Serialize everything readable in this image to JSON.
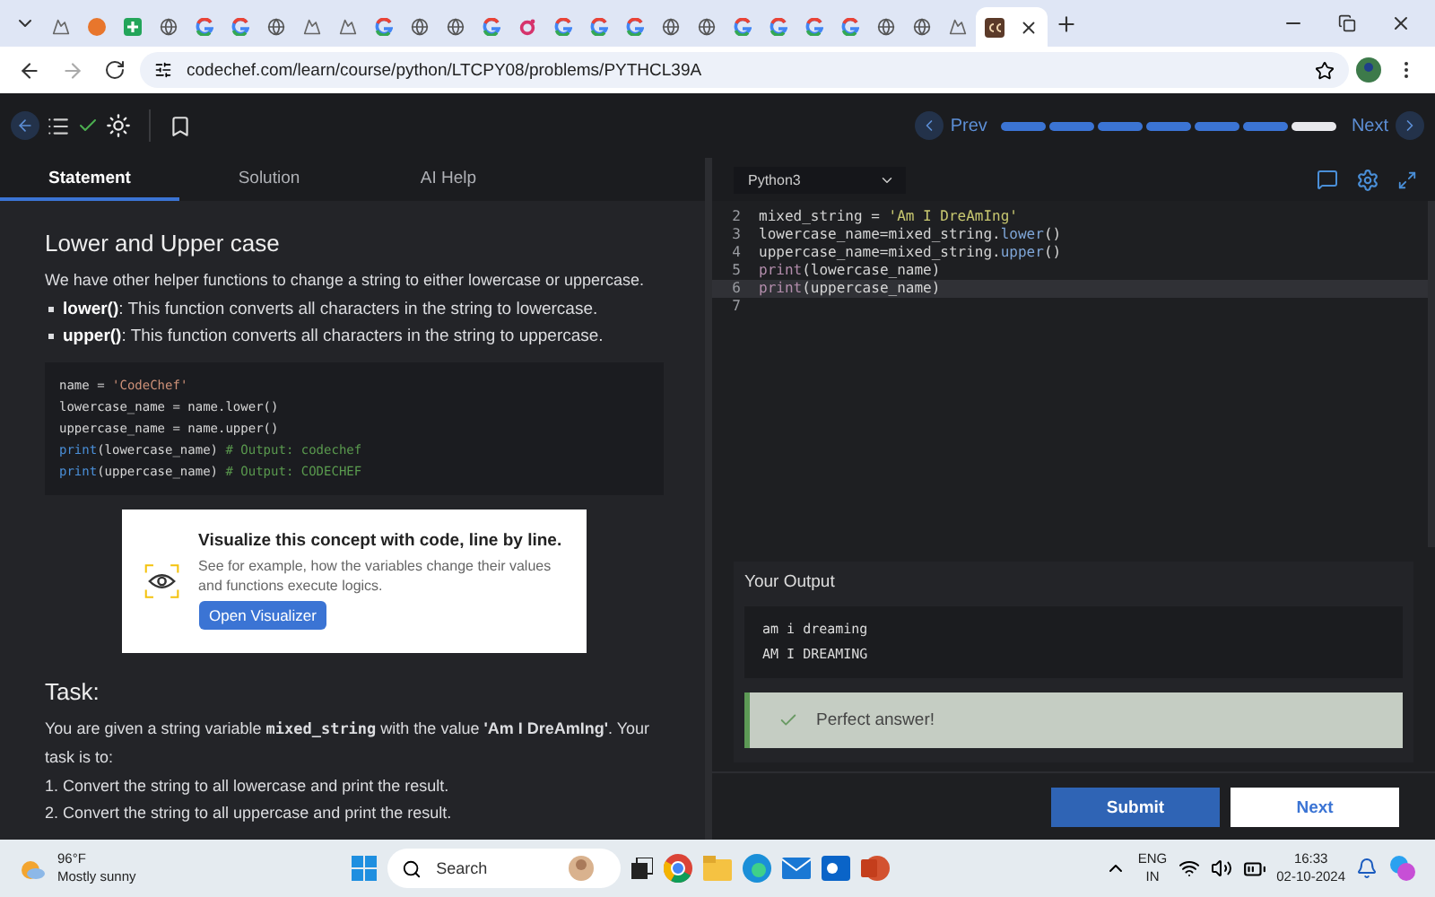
{
  "browser": {
    "tabs": [
      {
        "kind": "mountain",
        "selected": false
      },
      {
        "kind": "ball",
        "selected": false
      },
      {
        "kind": "plus",
        "selected": false
      },
      {
        "kind": "globe",
        "selected": false
      },
      {
        "kind": "ring",
        "selected": false
      },
      {
        "kind": "ring",
        "selected": false
      },
      {
        "kind": "globe",
        "selected": false
      },
      {
        "kind": "mountain",
        "selected": false
      },
      {
        "kind": "mountain",
        "selected": false
      },
      {
        "kind": "ring",
        "selected": false
      },
      {
        "kind": "globe",
        "selected": false
      },
      {
        "kind": "globe",
        "selected": false
      },
      {
        "kind": "ring",
        "selected": false
      },
      {
        "kind": "redring",
        "selected": false
      },
      {
        "kind": "ring",
        "selected": false
      },
      {
        "kind": "ring",
        "selected": false
      },
      {
        "kind": "ring",
        "selected": false
      },
      {
        "kind": "globe",
        "selected": false
      },
      {
        "kind": "globe",
        "selected": false
      },
      {
        "kind": "ring",
        "selected": false
      },
      {
        "kind": "ring",
        "selected": false
      },
      {
        "kind": "ring",
        "selected": false
      },
      {
        "kind": "ring",
        "selected": false
      },
      {
        "kind": "globe",
        "selected": false
      },
      {
        "kind": "globe",
        "selected": false
      },
      {
        "kind": "mountain",
        "selected": false
      },
      {
        "kind": "logo",
        "selected": true
      }
    ],
    "url": "codechef.com/learn/course/python/LTCPY08/problems/PYTHCL39A"
  },
  "toolbar": {
    "prev": "Prev",
    "next": "Next",
    "progress": [
      {
        "done": true
      },
      {
        "done": true
      },
      {
        "done": true
      },
      {
        "done": true
      },
      {
        "done": true
      },
      {
        "done": true
      },
      {
        "done": false
      }
    ]
  },
  "left_tabs": [
    {
      "label": "Statement",
      "selected": true
    },
    {
      "label": "Solution",
      "selected": false
    },
    {
      "label": "AI Help",
      "selected": false
    }
  ],
  "statement": {
    "heading": "Lower and Upper case",
    "intro": "We have other helper functions to change a string to either lowercase or uppercase.",
    "bullets": [
      "**lower()**: This function converts all characters in the string to lowercase.",
      "**upper()**: This function converts all characters in the string to uppercase."
    ],
    "code": [
      [
        {
          "kind": "plain",
          "text": "name = "
        },
        {
          "kind": "string",
          "text": "'CodeChef'"
        }
      ],
      [
        {
          "kind": "plain",
          "text": "lowercase_name = name.lower()"
        }
      ],
      [
        {
          "kind": "plain",
          "text": "uppercase_name = name.upper()"
        }
      ],
      [
        {
          "kind": "keyword",
          "text": "print"
        },
        {
          "kind": "plain",
          "text": "(lowercase_name) "
        },
        {
          "kind": "comment",
          "text": "# Output: codechef"
        }
      ],
      [
        {
          "kind": "keyword",
          "text": "print"
        },
        {
          "kind": "plain",
          "text": "(uppercase_name) "
        },
        {
          "kind": "comment",
          "text": "# Output: CODECHEF"
        }
      ]
    ],
    "visualizer": {
      "title": "Visualize this concept with code, line by line.",
      "text": "See for example, how the variables change their values and functions execute logics.",
      "button": "Open Visualizer"
    },
    "task_heading": "Task:",
    "task_text": [
      {
        "kind": "plain",
        "text": "You are given a string variable "
      },
      {
        "kind": "code",
        "text": "mixed_string"
      },
      {
        "kind": "plain",
        "text": " with the value "
      },
      {
        "kind": "bold",
        "text": "'Am I DreAmIng'"
      },
      {
        "kind": "plain",
        "text": ". Your task is to:"
      }
    ],
    "steps": [
      "1. Convert the string to all lowercase and print the result.",
      "2. Convert the string to all uppercase and print the result."
    ]
  },
  "editor": {
    "language": "Python3",
    "lines": [
      {
        "number": "2",
        "current": false,
        "tokens": [
          {
            "kind": "plain",
            "text": "mixed_string = "
          },
          {
            "kind": "string",
            "text": "'Am I DreAmIng'"
          }
        ]
      },
      {
        "number": "3",
        "current": false,
        "tokens": [
          {
            "kind": "plain",
            "text": "lowercase_name=mixed_string."
          },
          {
            "kind": "method",
            "text": "lower"
          },
          {
            "kind": "plain",
            "text": "()"
          }
        ]
      },
      {
        "number": "4",
        "current": false,
        "tokens": [
          {
            "kind": "plain",
            "text": "uppercase_name=mixed_string."
          },
          {
            "kind": "method",
            "text": "upper"
          },
          {
            "kind": "plain",
            "text": "()"
          }
        ]
      },
      {
        "number": "5",
        "current": false,
        "tokens": [
          {
            "kind": "keyword",
            "text": "print"
          },
          {
            "kind": "plain",
            "text": "(lowercase_name)"
          }
        ]
      },
      {
        "number": "6",
        "current": true,
        "tokens": [
          {
            "kind": "keyword",
            "text": "print"
          },
          {
            "kind": "plain",
            "text": "(uppercase_name)"
          }
        ]
      },
      {
        "number": "7",
        "current": false
      }
    ]
  },
  "output": {
    "title": "Your Output",
    "lines": [
      "am i dreaming",
      "AM I DREAMING"
    ],
    "result": "Perfect answer!"
  },
  "buttons": [
    {
      "label": "Submit",
      "kind": "primary"
    },
    {
      "label": "Next",
      "kind": "secondary"
    }
  ],
  "taskbar": {
    "temp": "96°F",
    "weather": "Mostly sunny",
    "placeholder": "Search",
    "lang": "ENG",
    "region": "IN",
    "time": "16:33",
    "date": "02-10-2024"
  }
}
